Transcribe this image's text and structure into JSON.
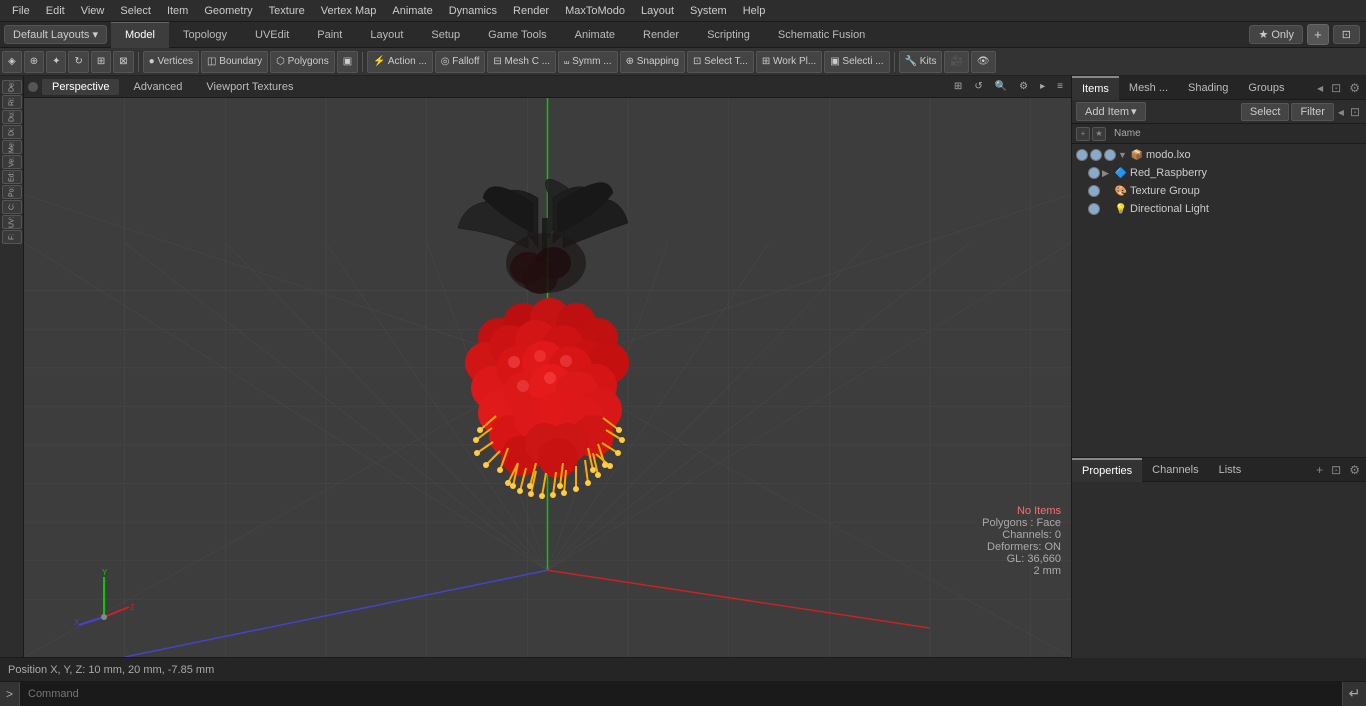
{
  "menu": {
    "items": [
      "File",
      "Edit",
      "View",
      "Select",
      "Item",
      "Geometry",
      "Texture",
      "Vertex Map",
      "Animate",
      "Dynamics",
      "Render",
      "MaxToModo",
      "Layout",
      "System",
      "Help"
    ]
  },
  "layout_bar": {
    "default_layouts": "Default Layouts ▾",
    "tabs": [
      "Model",
      "Topology",
      "UVEdit",
      "Paint",
      "Layout",
      "Setup",
      "Game Tools",
      "Animate",
      "Render",
      "Scripting",
      "Schematic Fusion"
    ],
    "add_tab": "+",
    "only_btn": "★ Only",
    "expand_btn": "⊡"
  },
  "toolbar": {
    "buttons": [
      {
        "id": "sel1",
        "label": "◈",
        "title": "select"
      },
      {
        "id": "sel2",
        "label": "⊕",
        "title": "select2"
      },
      {
        "id": "move",
        "label": "✦",
        "title": "move"
      },
      {
        "id": "rot",
        "label": "↻",
        "title": "rotate"
      },
      {
        "id": "scale",
        "label": "⊞",
        "title": "scale"
      },
      {
        "id": "tf",
        "label": "⊠",
        "title": "transform"
      },
      {
        "id": "vertices",
        "label": "Vertices",
        "title": "vertices",
        "active": false
      },
      {
        "id": "boundary",
        "label": "Boundary",
        "title": "boundary",
        "active": false
      },
      {
        "id": "polygons",
        "label": "Polygons",
        "title": "polygons",
        "active": false
      },
      {
        "id": "item",
        "label": "▣",
        "title": "item"
      },
      {
        "id": "action",
        "label": "Action ...",
        "title": "action"
      },
      {
        "id": "falloff",
        "label": "Falloff",
        "title": "falloff"
      },
      {
        "id": "meshc",
        "label": "Mesh C ...",
        "title": "mesh constraints"
      },
      {
        "id": "symm",
        "label": "Symm ...",
        "title": "symmetry"
      },
      {
        "id": "snap",
        "label": "⊕ Snapping",
        "title": "snapping"
      },
      {
        "id": "selectt",
        "label": "Select T...",
        "title": "select through"
      },
      {
        "id": "workpl",
        "label": "Work Pl...",
        "title": "work plane"
      },
      {
        "id": "selecti",
        "label": "Selecti ...",
        "title": "selection"
      },
      {
        "id": "kits",
        "label": "Kits",
        "title": "kits"
      },
      {
        "id": "cam1",
        "label": "🎥",
        "title": "camera1"
      },
      {
        "id": "cam2",
        "label": "👁",
        "title": "camera2"
      }
    ]
  },
  "viewport": {
    "tabs": [
      "Perspective",
      "Advanced",
      "Viewport Textures"
    ],
    "controls": [
      "⊞",
      "↺",
      "🔍",
      "⚙",
      "▸",
      "≡"
    ],
    "status": {
      "no_items": "No Items",
      "polygons": "Polygons : Face",
      "channels": "Channels: 0",
      "deformers": "Deformers: ON",
      "gl": "GL: 36,660",
      "measure": "2 mm"
    }
  },
  "left_toolbar": {
    "buttons": [
      "De:",
      "Ri:",
      "Du:",
      "Di:",
      "Me:",
      "Ve:",
      "Ed:",
      "Po:",
      "C:",
      "UV:",
      "F:"
    ]
  },
  "right_panel": {
    "tabs": [
      "Items",
      "Mesh ...",
      "Shading",
      "Groups"
    ],
    "toolbar": {
      "add_item": "Add Item",
      "add_item_arrow": "▾",
      "select_btn": "Select",
      "filter_btn": "Filter",
      "collapse": "◂",
      "expand": "⊡"
    },
    "col_icons": [
      "+",
      "★"
    ],
    "name_col": "Name",
    "items": [
      {
        "id": "modo-lxo",
        "label": "modo.lxo",
        "indent": 0,
        "icon": "📦",
        "type": "file",
        "visible": true,
        "expand": "▼"
      },
      {
        "id": "red-raspberry",
        "label": "Red_Raspberry",
        "indent": 1,
        "icon": "🔷",
        "type": "mesh",
        "visible": true,
        "expand": "▶"
      },
      {
        "id": "texture-group",
        "label": "Texture Group",
        "indent": 1,
        "icon": "🎨",
        "type": "texture",
        "visible": true,
        "expand": ""
      },
      {
        "id": "directional-light",
        "label": "Directional Light",
        "indent": 1,
        "icon": "💡",
        "type": "light",
        "visible": true,
        "expand": ""
      }
    ]
  },
  "properties_panel": {
    "tabs": [
      "Properties",
      "Channels",
      "Lists"
    ],
    "add_btn": "+",
    "expand_btns": [
      "⊡",
      "⚙"
    ]
  },
  "status_bar": {
    "position_label": "Position X, Y, Z:",
    "position_value": "10 mm, 20 mm, -7.85 mm"
  },
  "command_bar": {
    "prompt": ">",
    "placeholder": "Command",
    "execute": "↵"
  }
}
